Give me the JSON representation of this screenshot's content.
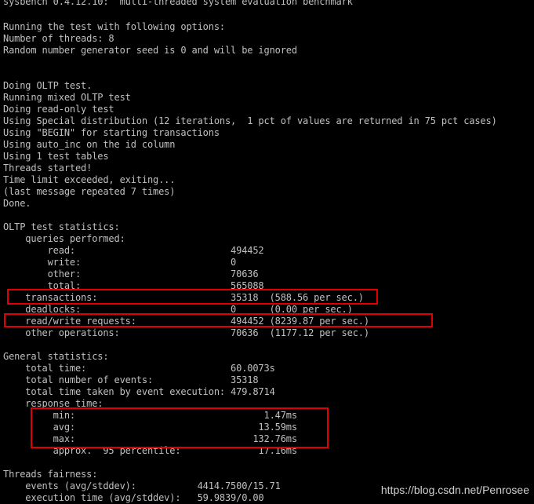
{
  "terminal": {
    "lines": [
      "sysbench 0.4.12.10:  multi-threaded system evaluation benchmark",
      "",
      "Running the test with following options:",
      "Number of threads: 8",
      "Random number generator seed is 0 and will be ignored",
      "",
      "",
      "Doing OLTP test.",
      "Running mixed OLTP test",
      "Doing read-only test",
      "Using Special distribution (12 iterations,  1 pct of values are returned in 75 pct cases)",
      "Using \"BEGIN\" for starting transactions",
      "Using auto_inc on the id column",
      "Using 1 test tables",
      "Threads started!",
      "Time limit exceeded, exiting...",
      "(last message repeated 7 times)",
      "Done.",
      "",
      "OLTP test statistics:",
      "    queries performed:",
      "        read:                            494452",
      "        write:                           0",
      "        other:                           70636",
      "        total:                           565088",
      "    transactions:                        35318  (588.56 per sec.)",
      "    deadlocks:                           0      (0.00 per sec.)",
      "    read/write requests:                 494452 (8239.87 per sec.)",
      "    other operations:                    70636  (1177.12 per sec.)",
      "",
      "General statistics:",
      "    total time:                          60.0073s",
      "    total number of events:              35318",
      "    total time taken by event execution: 479.8714",
      "    response time:",
      "         min:                                  1.47ms",
      "         avg:                                 13.59ms",
      "         max:                                132.76ms",
      "         approx.  95 percentile:              17.16ms",
      "",
      "Threads fairness:",
      "    events (avg/stddev):           4414.7500/15.71",
      "    execution time (avg/stddev):   59.9839/0.00"
    ]
  },
  "watermark": "https://blog.csdn.net/Penrosee",
  "colors": {
    "background": "#000000",
    "text": "#c0c0c0",
    "highlight_border": "#e00000"
  }
}
